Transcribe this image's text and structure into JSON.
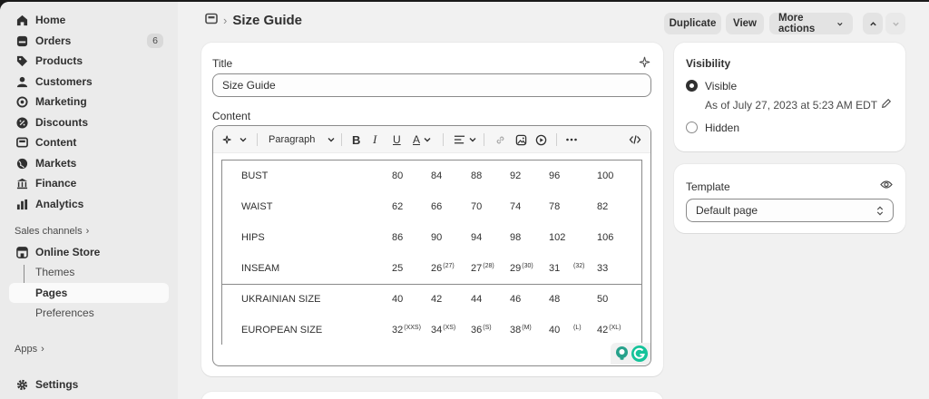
{
  "sidebar": {
    "items": [
      {
        "label": "Home",
        "icon": "home-icon"
      },
      {
        "label": "Orders",
        "icon": "orders-icon",
        "badge": "6"
      },
      {
        "label": "Products",
        "icon": "tag-icon"
      },
      {
        "label": "Customers",
        "icon": "person-icon"
      },
      {
        "label": "Marketing",
        "icon": "target-icon"
      },
      {
        "label": "Discounts",
        "icon": "discount-icon"
      },
      {
        "label": "Content",
        "icon": "content-icon"
      },
      {
        "label": "Markets",
        "icon": "globe-icon"
      },
      {
        "label": "Finance",
        "icon": "bank-icon"
      },
      {
        "label": "Analytics",
        "icon": "bar-chart-icon"
      }
    ],
    "sales_channels_label": "Sales channels",
    "online_store_label": "Online Store",
    "sub_items": [
      {
        "label": "Themes"
      },
      {
        "label": "Pages"
      },
      {
        "label": "Preferences"
      }
    ],
    "apps_label": "Apps",
    "settings_label": "Settings"
  },
  "header": {
    "title": "Size Guide",
    "duplicate_label": "Duplicate",
    "view_label": "View",
    "more_actions_label": "More actions"
  },
  "editor_card": {
    "title_label": "Title",
    "title_value": "Size Guide",
    "content_label": "Content",
    "paragraph_label": "Paragraph"
  },
  "size_table": {
    "rows": [
      {
        "label": "BUST",
        "cells": [
          [
            "80",
            ""
          ],
          [
            "84",
            ""
          ],
          [
            "88",
            ""
          ],
          [
            "92",
            ""
          ],
          [
            "96",
            ""
          ],
          [
            "",
            ""
          ],
          [
            "100",
            ""
          ]
        ]
      },
      {
        "label": "WAIST",
        "cells": [
          [
            "62",
            ""
          ],
          [
            "66",
            ""
          ],
          [
            "70",
            ""
          ],
          [
            "74",
            ""
          ],
          [
            "78",
            ""
          ],
          [
            "",
            ""
          ],
          [
            "82",
            ""
          ]
        ]
      },
      {
        "label": "HIPS",
        "cells": [
          [
            "86",
            ""
          ],
          [
            "90",
            ""
          ],
          [
            "94",
            ""
          ],
          [
            "98",
            ""
          ],
          [
            "102",
            ""
          ],
          [
            "",
            ""
          ],
          [
            "106",
            ""
          ]
        ]
      },
      {
        "label": "INSEAM",
        "cells": [
          [
            "25",
            ""
          ],
          [
            "26",
            "(27)"
          ],
          [
            "27",
            "(28)"
          ],
          [
            "29",
            "(30)"
          ],
          [
            "31",
            ""
          ],
          [
            "",
            "(32)"
          ],
          [
            "33",
            ""
          ]
        ]
      },
      {
        "label": "UKRAINIAN SIZE",
        "cells": [
          [
            "40",
            ""
          ],
          [
            "42",
            ""
          ],
          [
            "44",
            ""
          ],
          [
            "46",
            ""
          ],
          [
            "48",
            ""
          ],
          [
            "",
            ""
          ],
          [
            "50",
            ""
          ]
        ]
      },
      {
        "label": "EUROPEAN SIZE",
        "cells": [
          [
            "32",
            "(XXS)"
          ],
          [
            "34",
            "(XS)"
          ],
          [
            "36",
            "(S)"
          ],
          [
            "38",
            "(M)"
          ],
          [
            "40",
            ""
          ],
          [
            "",
            "(L)"
          ],
          [
            "42",
            "(XL)"
          ]
        ]
      }
    ]
  },
  "visibility": {
    "title": "Visibility",
    "visible_label": "Visible",
    "visible_date": "As of July 27, 2023 at 5:23 AM EDT",
    "hidden_label": "Hidden",
    "selected": "Visible"
  },
  "template": {
    "title": "Template",
    "value": "Default page"
  }
}
